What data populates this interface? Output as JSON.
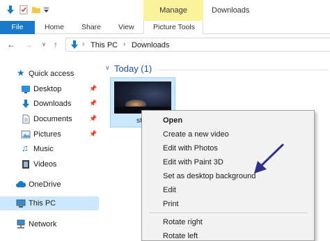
{
  "titlebar": {
    "context_tab": "Manage",
    "window_title": "Downloads"
  },
  "ribbon": {
    "tabs": [
      {
        "label": "File"
      },
      {
        "label": "Home"
      },
      {
        "label": "Share"
      },
      {
        "label": "View"
      },
      {
        "label": "Picture Tools"
      }
    ]
  },
  "address": {
    "crumbs": [
      "This PC",
      "Downloads"
    ]
  },
  "sidebar": {
    "items": [
      {
        "label": "Quick access",
        "icon": "star-icon"
      },
      {
        "label": "Desktop",
        "icon": "desktop-icon",
        "pinned": true
      },
      {
        "label": "Downloads",
        "icon": "download-arrow-icon",
        "pinned": true
      },
      {
        "label": "Documents",
        "icon": "document-icon",
        "pinned": true
      },
      {
        "label": "Pictures",
        "icon": "picture-icon",
        "pinned": true
      },
      {
        "label": "Music",
        "icon": "music-note-icon"
      },
      {
        "label": "Videos",
        "icon": "film-icon"
      },
      {
        "label": "OneDrive",
        "icon": "cloud-icon"
      },
      {
        "label": "This PC",
        "icon": "computer-icon",
        "selected": true
      },
      {
        "label": "Network",
        "icon": "network-icon"
      }
    ]
  },
  "content": {
    "group_header": "Today (1)",
    "file": {
      "name_fragment": "st"
    }
  },
  "context_menu": {
    "items": [
      {
        "label": "Open",
        "bold": true
      },
      {
        "label": "Create a new video"
      },
      {
        "label": "Edit with Photos"
      },
      {
        "label": "Edit with Paint 3D"
      },
      {
        "label": "Set as desktop background"
      },
      {
        "label": "Edit"
      },
      {
        "label": "Print"
      },
      {
        "label": "Rotate right"
      },
      {
        "label": "Rotate left"
      }
    ]
  },
  "colors": {
    "accent": "#1979ca",
    "manage_tab": "#fbf39b",
    "selection": "#cce8ff",
    "arrow": "#2f2f8c"
  }
}
